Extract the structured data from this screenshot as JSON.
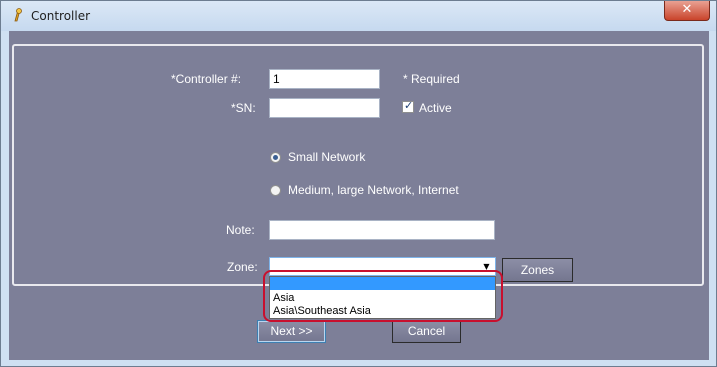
{
  "window": {
    "title": "Controller",
    "close_label": "✕"
  },
  "form": {
    "controller_label": "*Controller #:",
    "controller_value": "1",
    "required_note": "* Required",
    "sn_label": "*SN:",
    "sn_value": "",
    "active_label": "Active",
    "active_checked": true,
    "network_small_label": "Small Network",
    "network_large_label": "Medium, large Network, Internet",
    "network_selected": "Small Network",
    "note_label": "Note:",
    "note_value": "",
    "zone_label": "Zone:",
    "zone_value": "",
    "zones_button": "Zones",
    "zone_options": [
      "",
      "Asia",
      "Asia\\Southeast Asia"
    ]
  },
  "buttons": {
    "next": "Next >>",
    "cancel": "Cancel"
  },
  "colors": {
    "client_bg": "#7d7f98",
    "selection": "#3399ff",
    "highlight": "#c8102e"
  }
}
